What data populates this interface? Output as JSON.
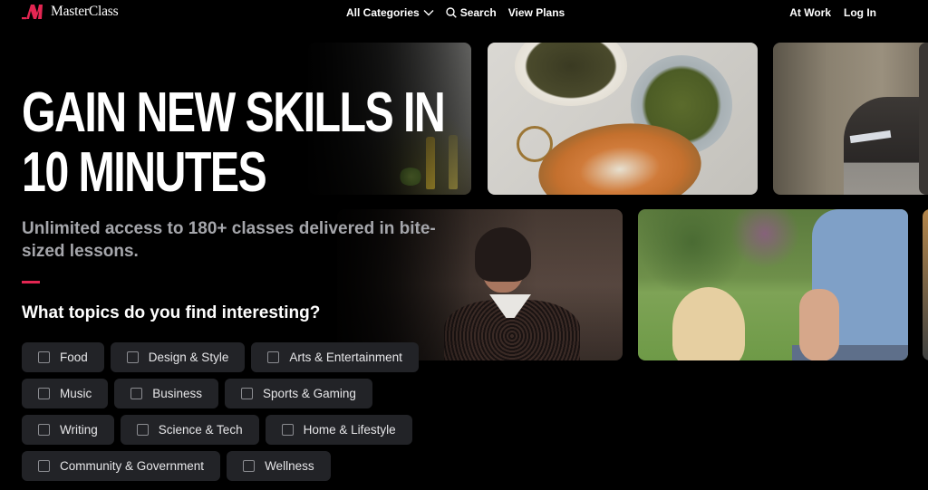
{
  "brand": {
    "name": "MasterClass",
    "accent_color": "#e32652"
  },
  "nav": {
    "categories_label": "All Categories",
    "search_label": "Search",
    "view_plans_label": "View Plans",
    "at_work_label": "At Work",
    "login_label": "Log In"
  },
  "hero": {
    "title_line1": "GAIN NEW SKILLS IN",
    "title_line2": "10 MINUTES",
    "subtitle": "Unlimited access to 180+ classes delivered in bite-sized lessons.",
    "question": "What topics do you find interesting?"
  },
  "topics": [
    {
      "label": "Food",
      "checked": false
    },
    {
      "label": "Design & Style",
      "checked": false
    },
    {
      "label": "Arts & Entertainment",
      "checked": false
    },
    {
      "label": "Music",
      "checked": false
    },
    {
      "label": "Business",
      "checked": false
    },
    {
      "label": "Sports & Gaming",
      "checked": false
    },
    {
      "label": "Writing",
      "checked": false
    },
    {
      "label": "Science & Tech",
      "checked": false
    },
    {
      "label": "Home & Lifestyle",
      "checked": false
    },
    {
      "label": "Community & Government",
      "checked": false
    },
    {
      "label": "Wellness",
      "checked": false
    }
  ],
  "tiles": [
    {
      "subject": "chef in kitchen"
    },
    {
      "subject": "plated dishes with roasted carrots"
    },
    {
      "subject": "director seated with script"
    },
    {
      "subject": "woman in white collar"
    },
    {
      "subject": "man training golden retriever puppy"
    }
  ]
}
